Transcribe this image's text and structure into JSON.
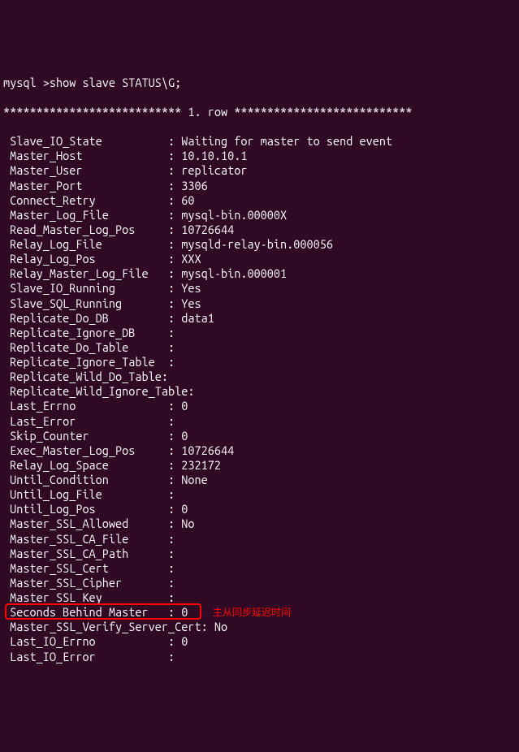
{
  "prompt": "mysql >show slave STATUS\\G;",
  "header": "*************************** 1. row ***************************",
  "fields": [
    {
      "name": "Slave_IO_State",
      "value": "Waiting for master to send event"
    },
    {
      "name": "Master_Host",
      "value": "10.10.10.1"
    },
    {
      "name": "Master_User",
      "value": "replicator"
    },
    {
      "name": "Master_Port",
      "value": "3306"
    },
    {
      "name": "Connect_Retry",
      "value": "60"
    },
    {
      "name": "Master_Log_File",
      "value": "mysql-bin.00000X"
    },
    {
      "name": "Read_Master_Log_Pos",
      "value": "10726644"
    },
    {
      "name": "Relay_Log_File",
      "value": "mysqld-relay-bin.000056"
    },
    {
      "name": "Relay_Log_Pos",
      "value": "XXX"
    },
    {
      "name": "Relay_Master_Log_File",
      "value": "mysql-bin.000001"
    },
    {
      "name": "Slave_IO_Running",
      "value": "Yes"
    },
    {
      "name": "Slave_SQL_Running",
      "value": "Yes"
    },
    {
      "name": "Replicate_Do_DB",
      "value": "data1"
    },
    {
      "name": "Replicate_Ignore_DB",
      "value": ""
    },
    {
      "name": "Replicate_Do_Table",
      "value": ""
    },
    {
      "name": "Replicate_Ignore_Table",
      "value": "",
      "nospace": true
    },
    {
      "name": "Replicate_Wild_Do_Table",
      "value": "",
      "noindent": true
    },
    {
      "name": "Replicate_Wild_Ignore_Table",
      "value": "",
      "noindent": true
    },
    {
      "name": "Last_Errno",
      "value": "0"
    },
    {
      "name": "Last_Error",
      "value": ""
    },
    {
      "name": "Skip_Counter",
      "value": "0"
    },
    {
      "name": "Exec_Master_Log_Pos",
      "value": "10726644"
    },
    {
      "name": "Relay_Log_Space",
      "value": "232172"
    },
    {
      "name": "Until_Condition",
      "value": "None"
    },
    {
      "name": "Until_Log_File",
      "value": ""
    },
    {
      "name": "Until_Log_Pos",
      "value": "0"
    },
    {
      "name": "Master_SSL_Allowed",
      "value": "No"
    },
    {
      "name": "Master_SSL_CA_File",
      "value": ""
    },
    {
      "name": "Master_SSL_CA_Path",
      "value": ""
    },
    {
      "name": "Master_SSL_Cert",
      "value": ""
    },
    {
      "name": "Master_SSL_Cipher",
      "value": ""
    },
    {
      "name": "Master_SSL_Key",
      "value": ""
    },
    {
      "name": "Seconds_Behind_Master",
      "value": "0",
      "highlight": true,
      "annotation": "主从同步延迟时间"
    },
    {
      "name": "Master_SSL_Verify_Server_Cert",
      "value": "No",
      "noindent": true
    },
    {
      "name": "Last_IO_Errno",
      "value": "0"
    },
    {
      "name": "Last_IO_Error",
      "value": ""
    }
  ]
}
